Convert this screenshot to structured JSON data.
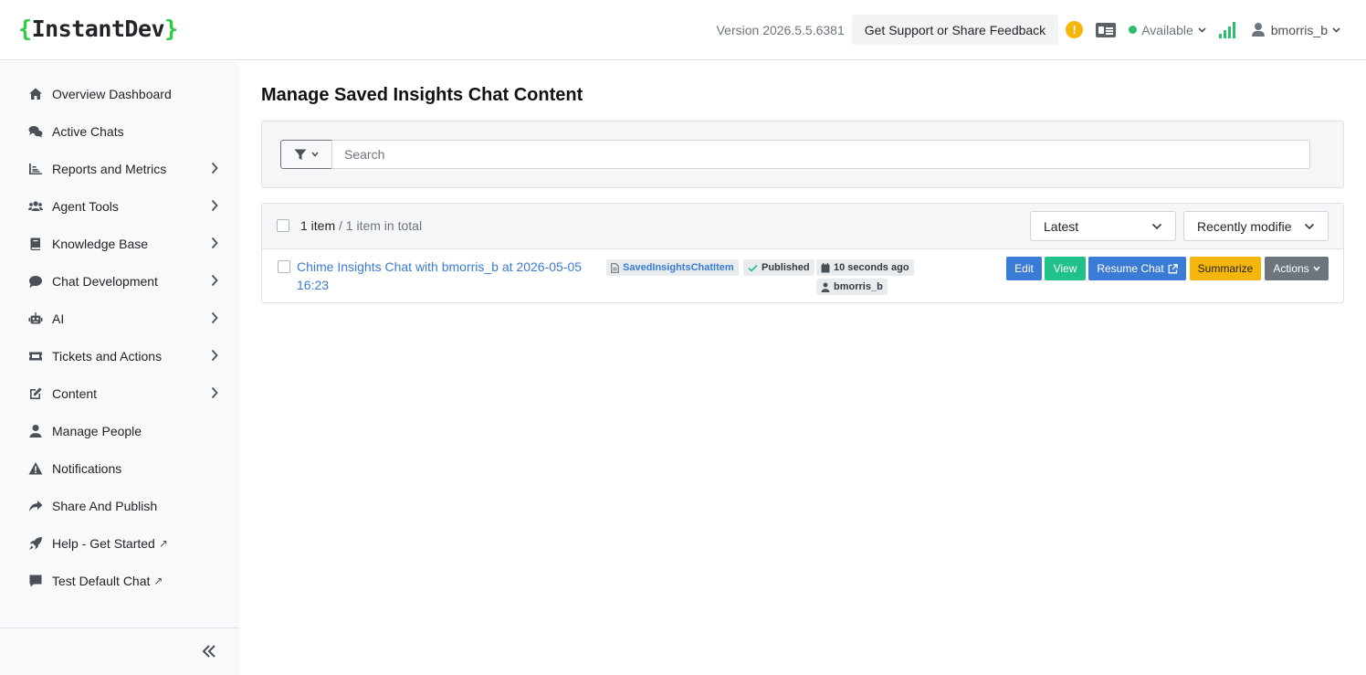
{
  "header": {
    "logo_open": "{",
    "logo_text": "InstantDev",
    "logo_close": "}",
    "version": "Version 2026.5.5.6381",
    "support_label": "Get Support or Share Feedback",
    "warning_icon_glyph": "!",
    "status": "Available",
    "username": "bmorris_b",
    "accent_color": "#2ecc40"
  },
  "sidebar": {
    "items": [
      {
        "label": "Overview Dashboard",
        "icon": "home-icon",
        "has_submenu": false
      },
      {
        "label": "Active Chats",
        "icon": "chats-icon",
        "has_submenu": false
      },
      {
        "label": "Reports and Metrics",
        "icon": "chart-icon",
        "has_submenu": true
      },
      {
        "label": "Agent Tools",
        "icon": "users-icon",
        "has_submenu": true
      },
      {
        "label": "Knowledge Base",
        "icon": "book-icon",
        "has_submenu": true
      },
      {
        "label": "Chat Development",
        "icon": "comment-icon",
        "has_submenu": true
      },
      {
        "label": "AI",
        "icon": "robot-icon",
        "has_submenu": true
      },
      {
        "label": "Tickets and Actions",
        "icon": "ticket-icon",
        "has_submenu": true
      },
      {
        "label": "Content",
        "icon": "edit-icon",
        "has_submenu": true
      },
      {
        "label": "Manage People",
        "icon": "user-icon",
        "has_submenu": false
      },
      {
        "label": "Notifications",
        "icon": "warning-icon",
        "has_submenu": false
      },
      {
        "label": "Share And Publish",
        "icon": "share-icon",
        "has_submenu": false
      },
      {
        "label": "Help - Get Started",
        "icon": "rocket-icon",
        "has_submenu": false,
        "external": "↗"
      },
      {
        "label": "Test Default Chat",
        "icon": "message-icon",
        "has_submenu": false,
        "external": "↗"
      }
    ]
  },
  "main": {
    "title": "Manage Saved Insights Chat Content",
    "search_placeholder": "Search",
    "list": {
      "count_main": "1 item",
      "count_total": " / 1 item in total",
      "sort_primary": "Latest",
      "sort_secondary": "Recently modifie",
      "rows": [
        {
          "title": "Chime Insights Chat with bmorris_b at 2026-05-05 16:23",
          "type_tag": "SavedInsightsChatItem",
          "status_tag": "Published",
          "time_tag": "10 seconds ago",
          "owner_tag": "bmorris_b",
          "buttons": {
            "edit": "Edit",
            "view": "View",
            "resume": "Resume Chat",
            "summarize": "Summarize",
            "actions": "Actions"
          }
        }
      ]
    }
  },
  "colors": {
    "edit": "#3a7bd5",
    "view": "#20c18a",
    "resume": "#3a7bd5",
    "summarize": "#f5b50a",
    "actions": "#6c757d",
    "link": "#3a7bd5"
  }
}
